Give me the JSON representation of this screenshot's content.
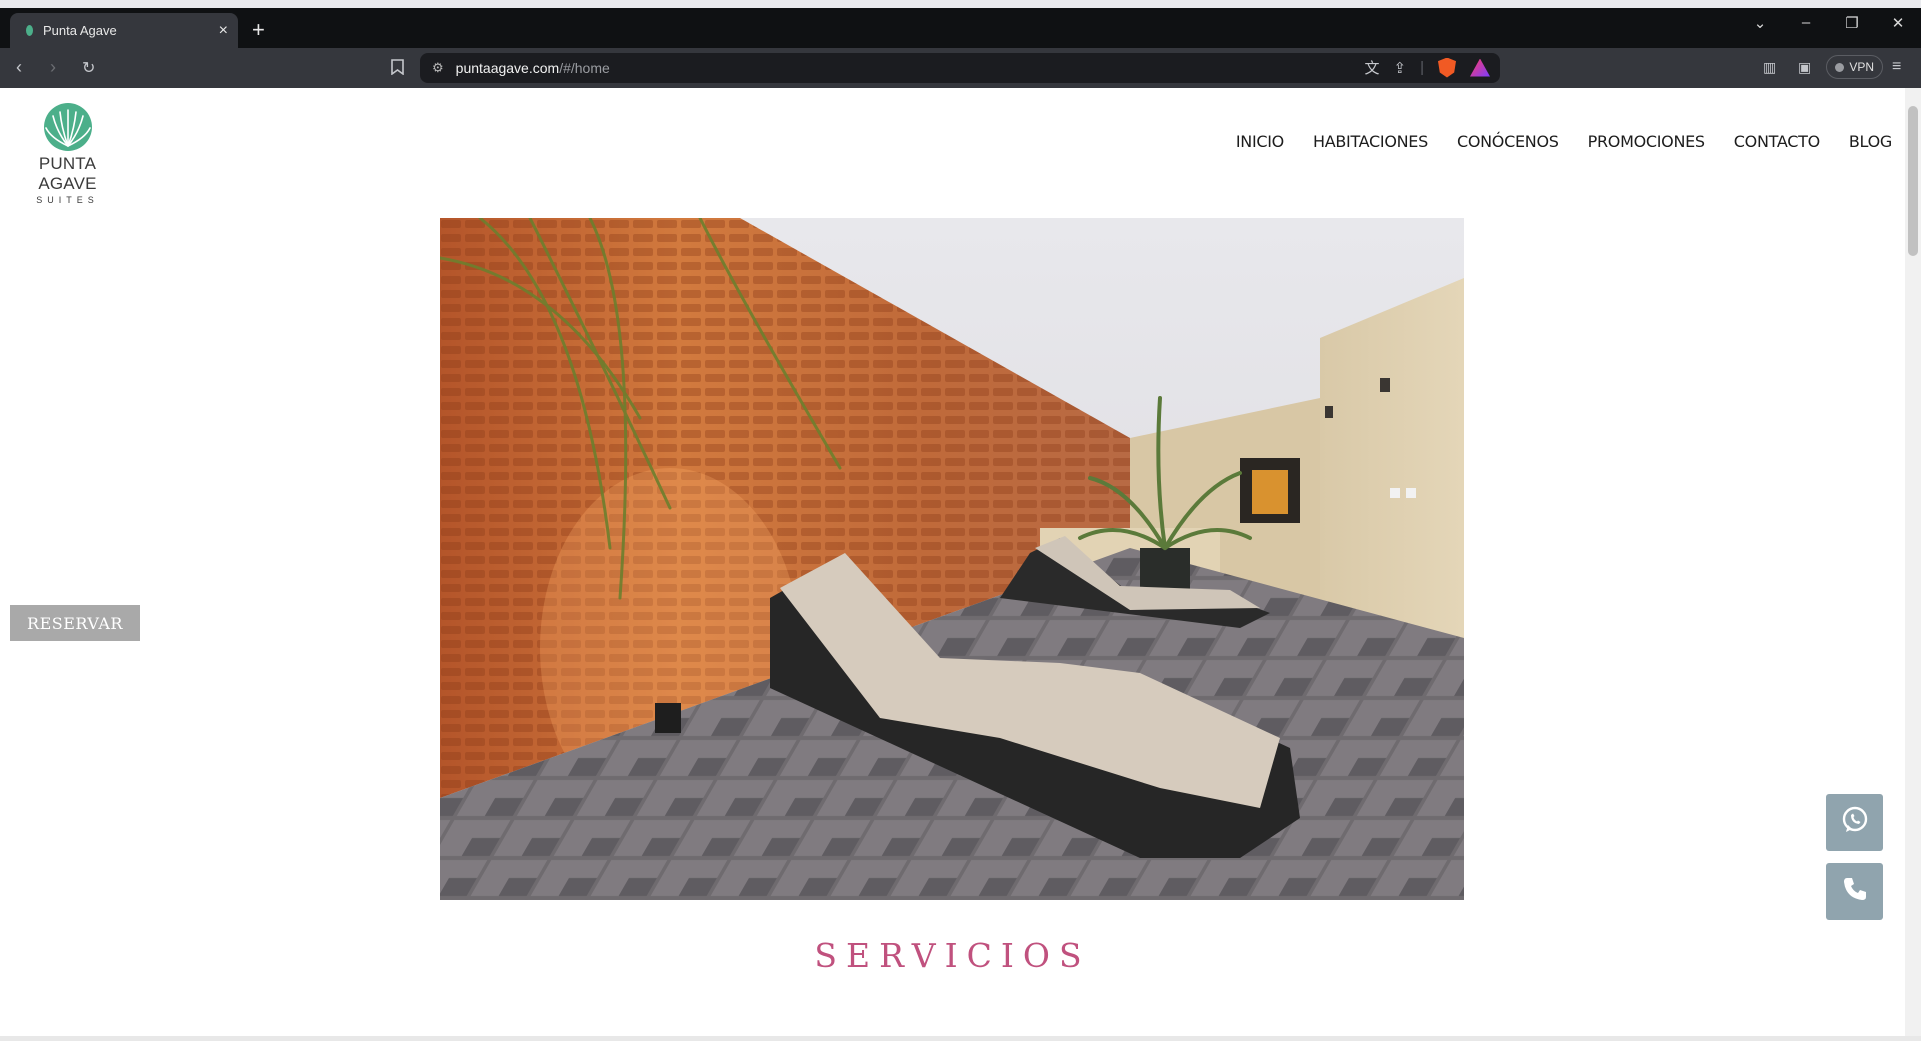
{
  "browser": {
    "tab_title": "Punta Agave",
    "tab_close": "×",
    "new_tab": "+",
    "url_host": "puntaagave.com",
    "url_path": "/#/home",
    "vpn_label": "VPN",
    "window_controls": [
      "⌄",
      "–",
      "❐",
      "✕"
    ]
  },
  "site": {
    "logo_name": "PUNTA AGAVE",
    "logo_sub": "SUITES",
    "nav": [
      "INICIO",
      "HABITACIONES",
      "CONÓCENOS",
      "PROMOCIONES",
      "CONTACTO",
      "BLOG"
    ],
    "reserve_label": "RESERVAR",
    "section_title": "SERVICIOS"
  },
  "colors": {
    "accent_pink": "#c0517e",
    "logo_green": "#4caf8a",
    "fab_grey": "#90a4ae",
    "reserve_grey": "#a9a9a9"
  }
}
